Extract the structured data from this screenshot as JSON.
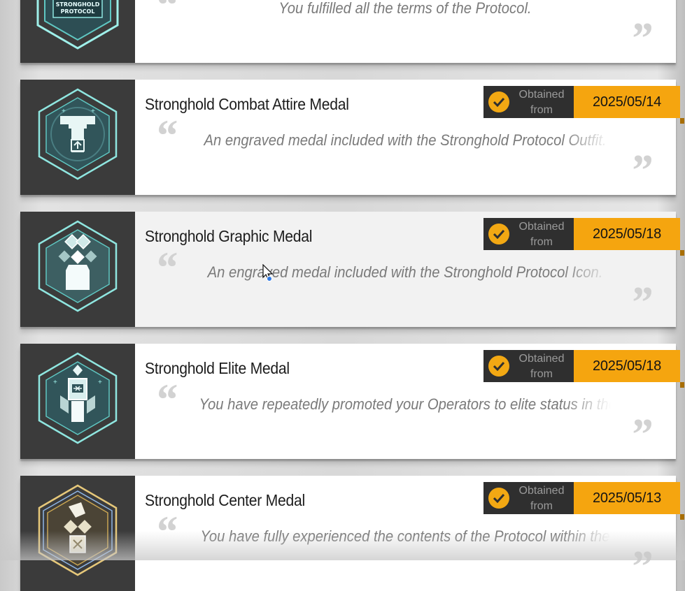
{
  "obtained_label": "Obtained from",
  "medals": [
    {
      "title": "",
      "description": "You fulfilled all the terms of the Protocol.",
      "date": "",
      "emblem_text": "STRONGHOLD PROTOCOL",
      "icon": "stronghold-protocol-medal-icon"
    },
    {
      "title": "Stronghold Combat Attire Medal",
      "description": "An engraved medal included with the Stronghold Protocol Outfit.",
      "date": "2025/05/14",
      "icon": "combat-attire-medal-icon"
    },
    {
      "title": "Stronghold Graphic Medal",
      "description": "An engraved medal included with the Stronghold Protocol Icon.",
      "date": "2025/05/18",
      "icon": "graphic-medal-icon"
    },
    {
      "title": "Stronghold Elite Medal",
      "description": "You have repeatedly promoted your Operators to elite status in the",
      "date": "2025/05/18",
      "icon": "elite-medal-icon"
    },
    {
      "title": "Stronghold Center Medal",
      "description": "You have fully experienced the contents of the Protocol within the",
      "date": "2025/05/13",
      "icon": "center-medal-icon"
    }
  ],
  "colors": {
    "accent": "#f5a50f",
    "badge_dark": "#2f2f2f",
    "thumb_bg": "#3b3b3b",
    "medal_teal": "#7fe3dd",
    "medal_gold": "#d9b45a"
  }
}
